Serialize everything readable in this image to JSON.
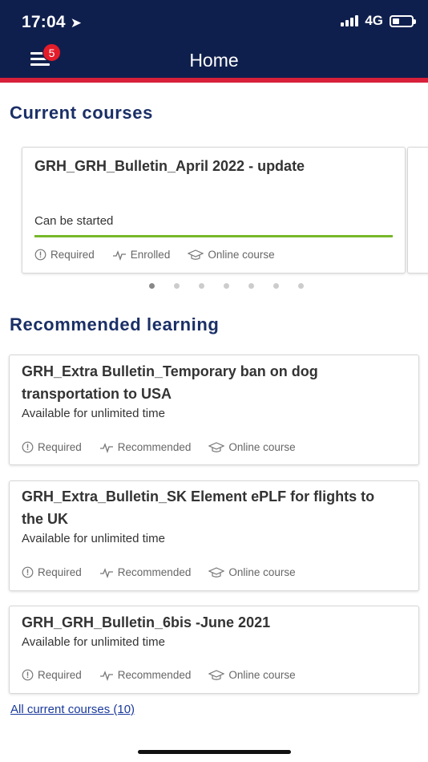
{
  "status_bar": {
    "time": "17:04",
    "network": "4G"
  },
  "header": {
    "title": "Home",
    "menu_badge": "5"
  },
  "current_courses": {
    "title": "Current courses",
    "cards": [
      {
        "title": "GRH_GRH_Bulletin_April 2022 - update",
        "status": "Can be started",
        "meta": [
          "Required",
          "Enrolled",
          "Online course"
        ]
      }
    ],
    "pager_count": 7,
    "pager_active": 0
  },
  "recommended": {
    "title": "Recommended learning",
    "cards": [
      {
        "title_line1": "GRH_Extra Bulletin_Temporary ban on dog",
        "title_line2": "transportation to USA",
        "availability": "Available for unlimited time",
        "meta": [
          "Required",
          "Recommended",
          "Online course"
        ]
      },
      {
        "title_line1": "GRH_Extra_Bulletin_SK Element ePLF for flights to",
        "title_line2": "the UK",
        "availability": "Available for unlimited time",
        "meta": [
          "Required",
          "Recommended",
          "Online course"
        ]
      },
      {
        "title_line1": "GRH_GRH_Bulletin_6bis -June 2021",
        "availability": "Available for unlimited time",
        "meta": [
          "Required",
          "Recommended",
          "Online course"
        ]
      }
    ]
  },
  "footer_link": "All current courses (10)",
  "colors": {
    "header_bg": "#0f1f4d",
    "accent_red": "#d8203a",
    "progress_green": "#77b82a",
    "section_title": "#1a2f66"
  }
}
